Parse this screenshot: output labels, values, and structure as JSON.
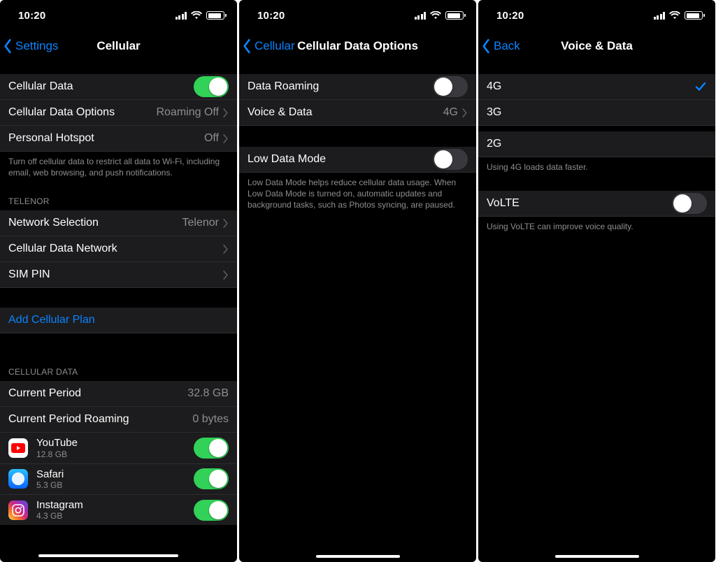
{
  "status": {
    "time": "10:20"
  },
  "colors": {
    "link": "#0b84ff",
    "toggle_on": "#32d158"
  },
  "screen1": {
    "back": "Settings",
    "title": "Cellular",
    "rows": {
      "cellular_data": "Cellular Data",
      "cellular_data_options": "Cellular Data Options",
      "cellular_data_options_value": "Roaming Off",
      "personal_hotspot": "Personal Hotspot",
      "personal_hotspot_value": "Off"
    },
    "note1": "Turn off cellular data to restrict all data to Wi-Fi, including email, web browsing, and push notifications.",
    "carrier_header": "Telenor",
    "network_selection": "Network Selection",
    "network_selection_value": "Telenor",
    "cellular_data_network": "Cellular Data Network",
    "sim_pin": "SIM PIN",
    "add_plan": "Add Cellular Plan",
    "usage_header": "Cellular Data",
    "current_period": "Current Period",
    "current_period_value": "32.8 GB",
    "current_period_roaming": "Current Period Roaming",
    "current_period_roaming_value": "0 bytes",
    "apps": [
      {
        "name": "YouTube",
        "usage": "12.8 GB",
        "on": true
      },
      {
        "name": "Safari",
        "usage": "5.3 GB",
        "on": true
      },
      {
        "name": "Instagram",
        "usage": "4.3 GB",
        "on": true
      }
    ]
  },
  "screen2": {
    "back": "Cellular",
    "title": "Cellular Data Options",
    "data_roaming": "Data Roaming",
    "voice_data": "Voice & Data",
    "voice_data_value": "4G",
    "low_data": "Low Data Mode",
    "note": "Low Data Mode helps reduce cellular data usage. When Low Data Mode is turned on, automatic updates and background tasks, such as Photos syncing, are paused."
  },
  "screen3": {
    "back": "Back",
    "title": "Voice & Data",
    "opts": {
      "g4": "4G",
      "g3": "3G",
      "g2": "2G"
    },
    "note1": "Using 4G loads data faster.",
    "volte": "VoLTE",
    "note2": "Using VoLTE can improve voice quality."
  }
}
